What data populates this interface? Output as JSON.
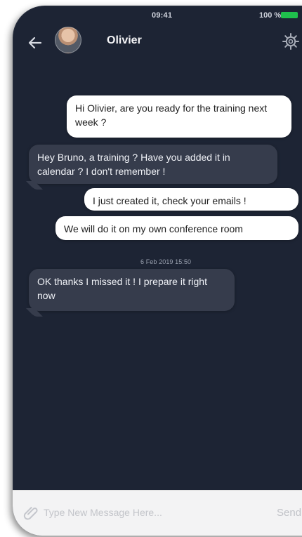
{
  "status_bar": {
    "time": "09:41",
    "battery": "100 %",
    "battery_color": "#1fbf4c"
  },
  "header": {
    "back_icon": "left-arrow-icon",
    "contact_name": "Olivier",
    "settings_icon": "gear-icon"
  },
  "messages": [
    {
      "direction": "outgoing",
      "text": "Hi Olivier, are you ready for the training next week ?"
    },
    {
      "direction": "incoming",
      "text": "Hey Bruno, a training ? Have you added it in calendar ? I don't remember !"
    },
    {
      "direction": "outgoing",
      "text": "I just created it, check your emails !"
    },
    {
      "direction": "outgoing",
      "text": "We will do it on my own conference room"
    },
    {
      "direction": "incoming",
      "text": "OK thanks I missed it ! I prepare it right now"
    }
  ],
  "timestamp": "6 Feb 2019 15:50",
  "composer": {
    "attach_icon": "paperclip-icon",
    "placeholder": "Type New Message Here...",
    "send_label": "Send"
  },
  "colors": {
    "chat_background": "#1d2434",
    "incoming_bubble": "#363c4c",
    "outgoing_bubble": "#ffffff",
    "composer_background": "#f3f3f4"
  }
}
